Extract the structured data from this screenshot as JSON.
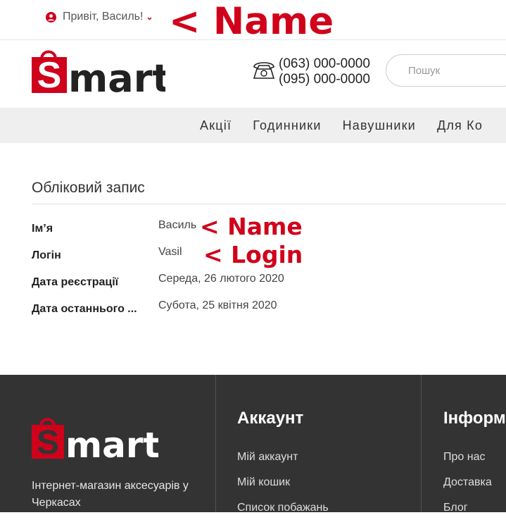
{
  "topbar": {
    "greeting": "Привіт, Василь!",
    "annotation": "< Name"
  },
  "header": {
    "logo_text": "mart",
    "phones": [
      "(063) 000-0000",
      "(095) 000-0000"
    ],
    "search_placeholder": "Пошук"
  },
  "nav": {
    "items": [
      "Акції",
      "Годинники",
      "Навушники",
      "Для Ко"
    ]
  },
  "account": {
    "title": "Обліковий запис",
    "rows": [
      {
        "label": "Ім’я",
        "value": "Василь",
        "annotation": "< Name"
      },
      {
        "label": "Логін",
        "value": "Vasil",
        "annotation": "< Login"
      },
      {
        "label": "Дата реєстрації",
        "value": "Середа, 26 лютого 2020"
      },
      {
        "label": "Дата останнього ...",
        "value": "Субота, 25 квітня 2020"
      }
    ]
  },
  "footer": {
    "logo_text": "mart",
    "description": "Інтернет-магазин аксесуарів у Черкасах",
    "account_heading": "Аккаунт",
    "account_links": [
      "Мій аккаунт",
      "Мій кошик",
      "Список побажань"
    ],
    "info_heading": "Інформ",
    "info_links": [
      "Про нас",
      "Доставка",
      "Блог"
    ]
  },
  "colors": {
    "brand_red": "#d0021b",
    "footer_bg": "#333333",
    "nav_bg": "#efefef"
  }
}
